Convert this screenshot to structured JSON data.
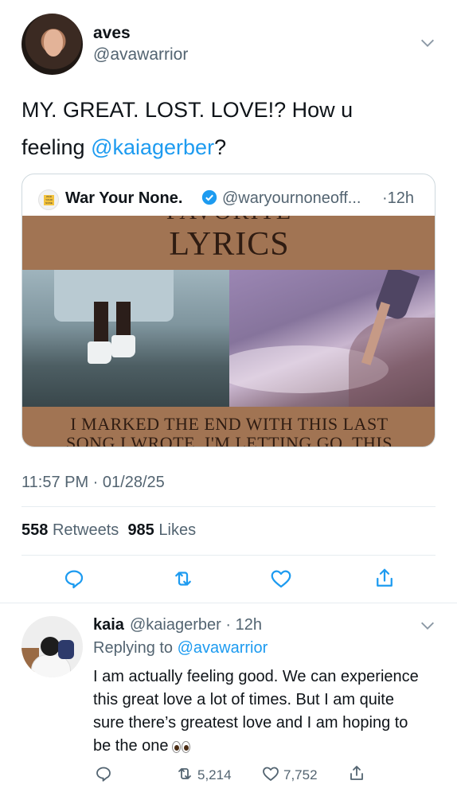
{
  "main_tweet": {
    "display_name": "aves",
    "handle": "@avawarrior",
    "text_line1": "MY. GREAT. LOST. LOVE!? How u",
    "text_line2_prefix": "feeling ",
    "text_mention": "@kaiagerber",
    "text_line2_suffix": "?",
    "timestamp": "11:57 PM · 01/28/25",
    "retweets_count": "558",
    "retweets_label": "Retweets",
    "likes_count": "985",
    "likes_label": "Likes"
  },
  "quoted_tweet": {
    "avatar_text": "WAR YOUR NONE",
    "display_name": "War Your None.",
    "handle": "@waryournoneoff...",
    "time": "·12h",
    "image_partial_title": "FAVORITE",
    "image_title": "LYRICS",
    "image_caption_line1": "I MARKED THE END WITH THIS LAST",
    "image_caption_line2": "SONG I WROTE, I'M LETTING GO. THIS"
  },
  "reply": {
    "display_name": "kaia",
    "handle_time": "@kaiagerber · 12h",
    "replying_prefix": "Replying to ",
    "replying_to": "@avawarrior",
    "text": "I am actually feeling good. We can experience this great love a lot of times. But I am quite sure there’s greatest love and I am hoping to be the one",
    "retweets": "5,214",
    "likes": "7,752"
  },
  "icons": {
    "reply": "reply-icon",
    "retweet": "retweet-icon",
    "like": "heart-icon",
    "share": "share-icon",
    "menu": "chevron-down-icon",
    "verified": "verified-badge-icon"
  },
  "colors": {
    "accent": "#1d9bf0",
    "secondary_text": "#536471",
    "divider": "#e6ecf0"
  }
}
